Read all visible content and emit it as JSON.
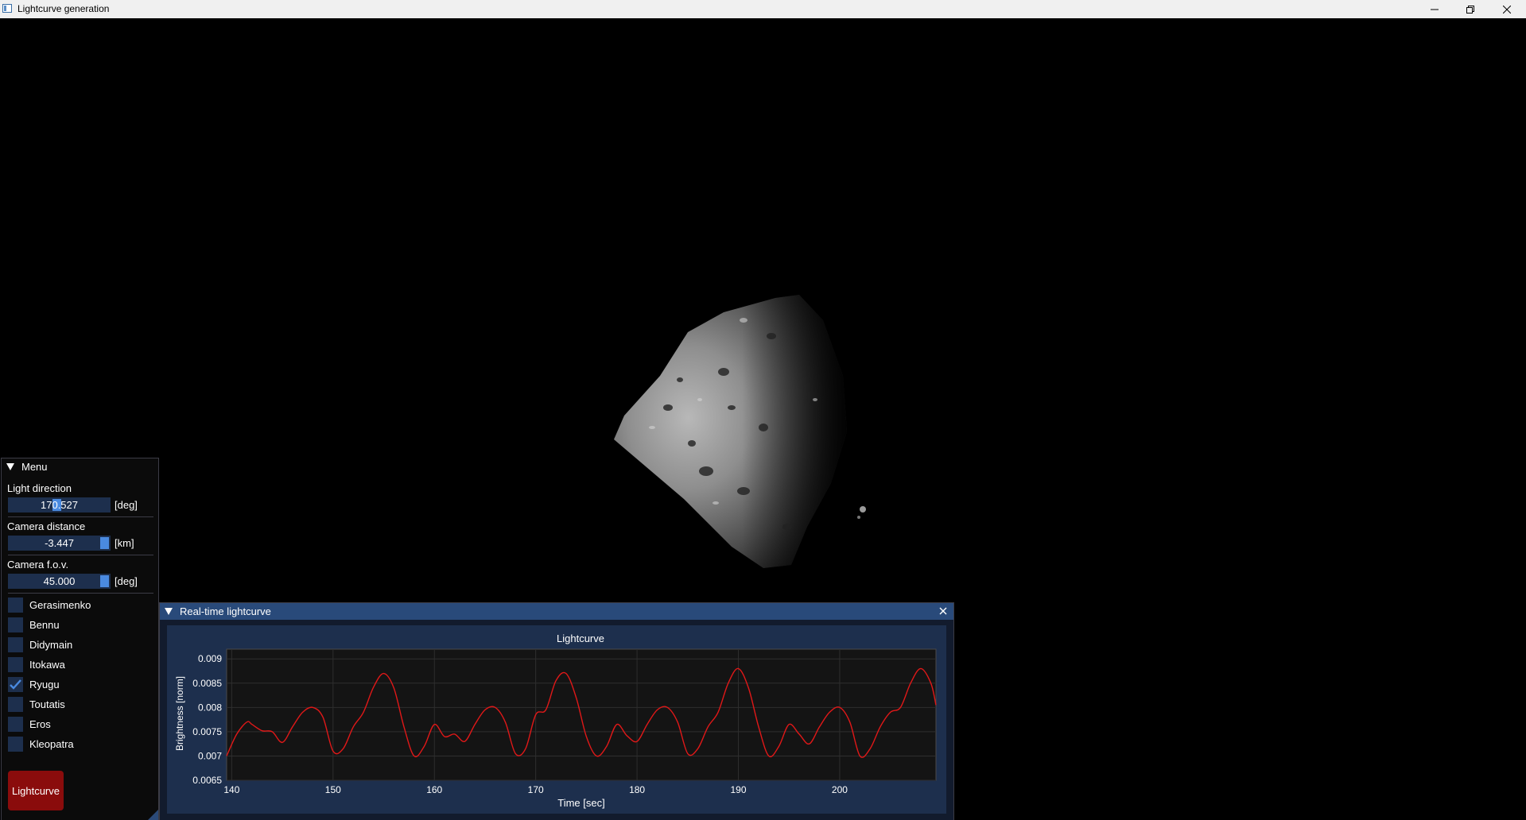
{
  "window": {
    "title": "Lightcurve generation",
    "controls": [
      "minimize",
      "restore",
      "close"
    ]
  },
  "menu": {
    "title": "Menu",
    "light_direction": {
      "label": "Light direction",
      "value": "170.527",
      "unit": "[deg]",
      "fraction": 0.47
    },
    "camera_distance": {
      "label": "Camera distance",
      "value": "-3.447",
      "unit": "[km]",
      "fraction": 1.0
    },
    "camera_fov": {
      "label": "Camera f.o.v.",
      "value": "45.000",
      "unit": "[deg]",
      "fraction": 1.0
    },
    "asteroids": [
      {
        "label": "Gerasimenko",
        "checked": false
      },
      {
        "label": "Bennu",
        "checked": false
      },
      {
        "label": "Didymain",
        "checked": false
      },
      {
        "label": "Itokawa",
        "checked": false
      },
      {
        "label": "Ryugu",
        "checked": true
      },
      {
        "label": "Toutatis",
        "checked": false
      },
      {
        "label": "Eros",
        "checked": false
      },
      {
        "label": "Kleopatra",
        "checked": false
      }
    ],
    "button_label": "Lightcurve"
  },
  "plot_window": {
    "title": "Real-time lightcurve"
  },
  "colors": {
    "accent": "#4a8ae0",
    "frame_bg": "#1d2f4d",
    "header": "#294a7a",
    "button": "#8a0c0c",
    "curve": "#e01818"
  },
  "chart_data": {
    "type": "line",
    "title": "Lightcurve",
    "xlabel": "Time [sec]",
    "ylabel": "Brightness [norm]",
    "xlim": [
      139.5,
      209.5
    ],
    "ylim": [
      0.0065,
      0.0092
    ],
    "xticks": [
      140,
      150,
      160,
      170,
      180,
      190,
      200
    ],
    "xtick_labels": [
      "140",
      "150",
      "160",
      "170",
      "180",
      "190",
      "200"
    ],
    "yticks": [
      0.009,
      0.0085,
      0.008,
      0.0075,
      0.007,
      0.0065
    ],
    "ytick_labels": [
      "0.009",
      "0.0085",
      "0.008",
      "0.0075",
      "0.007",
      "0.0065"
    ],
    "grid": true,
    "series": [
      {
        "x": [
          139.5,
          140.5,
          141.5,
          142.0,
          143.0,
          144.0,
          145.0,
          146.0,
          147.0,
          148.0,
          149.0,
          150.0,
          151.0,
          152.0,
          153.0,
          154.0,
          155.0,
          156.0,
          157.0,
          158.0,
          159.0,
          160.0,
          161.0,
          162.0,
          163.0,
          164.0,
          165.0,
          166.0,
          167.0,
          168.0,
          169.0,
          170.0,
          171.0,
          172.0,
          173.0,
          174.0,
          175.0,
          176.0,
          177.0,
          178.0,
          179.0,
          180.0,
          181.0,
          182.0,
          183.0,
          184.0,
          185.0,
          186.0,
          187.0,
          188.0,
          189.0,
          190.0,
          191.0,
          192.0,
          193.0,
          194.0,
          195.0,
          196.0,
          197.0,
          198.0,
          199.0,
          200.0,
          201.0,
          202.0,
          203.0,
          204.0,
          205.0,
          206.0,
          207.0,
          208.0,
          209.0,
          209.5
        ],
        "y": [
          0.007,
          0.00745,
          0.0077,
          0.00765,
          0.00752,
          0.0075,
          0.00728,
          0.0076,
          0.0079,
          0.008,
          0.0078,
          0.0071,
          0.00715,
          0.0076,
          0.0079,
          0.00842,
          0.0087,
          0.0084,
          0.0076,
          0.007,
          0.0072,
          0.00765,
          0.0074,
          0.00745,
          0.0073,
          0.00765,
          0.00795,
          0.008,
          0.0077,
          0.00705,
          0.00715,
          0.00785,
          0.00795,
          0.00855,
          0.0087,
          0.0082,
          0.0074,
          0.007,
          0.0072,
          0.00765,
          0.00742,
          0.0073,
          0.00765,
          0.00795,
          0.008,
          0.0077,
          0.00705,
          0.00715,
          0.0076,
          0.0079,
          0.0085,
          0.0088,
          0.0084,
          0.0076,
          0.007,
          0.0072,
          0.00765,
          0.00745,
          0.00725,
          0.0076,
          0.0079,
          0.008,
          0.0077,
          0.007,
          0.00715,
          0.0076,
          0.0079,
          0.008,
          0.0085,
          0.0088,
          0.0085,
          0.00805
        ]
      }
    ]
  }
}
